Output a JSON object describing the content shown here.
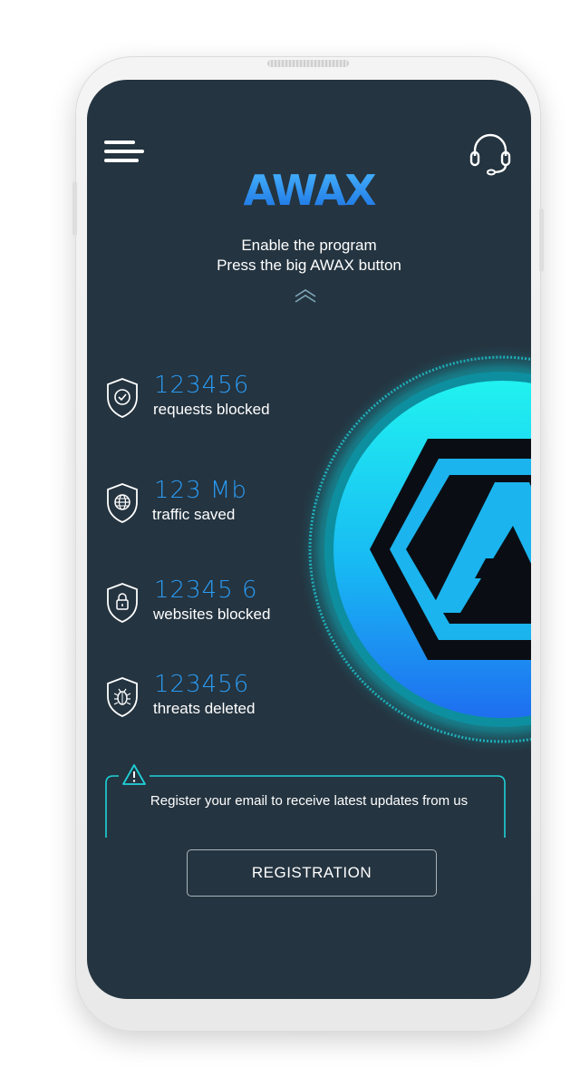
{
  "app": {
    "logo_text": "AWAX"
  },
  "header": {
    "menu_icon": "hamburger-menu-icon",
    "support_icon": "headset-support-icon"
  },
  "instructions": {
    "line1": "Enable the program",
    "line2": "Press the big AWAX button"
  },
  "stats": [
    {
      "value": "123456",
      "label": "requests blocked",
      "icon": "shield-check-icon"
    },
    {
      "value": "123 Mb",
      "label": "traffic saved",
      "icon": "shield-globe-icon"
    },
    {
      "value": "12345 6",
      "label": "websites blocked",
      "icon": "shield-lock-icon"
    },
    {
      "value": "123456",
      "label": "threats deleted",
      "icon": "shield-bug-icon"
    }
  ],
  "registration": {
    "warning_icon": "warning-triangle-icon",
    "message": "Register your email to receive latest updates from us",
    "button_label": "REGISTRATION"
  },
  "colors": {
    "screen_background": "#243440",
    "accent_blue": "#2b9bf4",
    "accent_cyan": "#16e0e8"
  }
}
